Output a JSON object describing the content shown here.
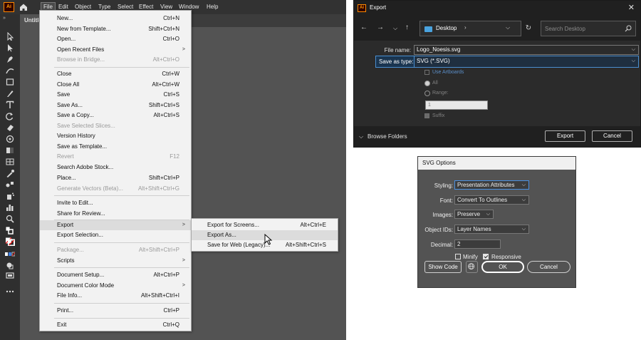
{
  "illustrator": {
    "app_logo": "Ai",
    "menubar": [
      "File",
      "Edit",
      "Object",
      "Type",
      "Select",
      "Effect",
      "View",
      "Window",
      "Help"
    ],
    "doc_tab": "Untitle",
    "file_menu": [
      {
        "label": "New...",
        "shortcut": "Ctrl+N"
      },
      {
        "label": "New from Template...",
        "shortcut": "Shift+Ctrl+N"
      },
      {
        "label": "Open...",
        "shortcut": "Ctrl+O"
      },
      {
        "label": "Open Recent Files",
        "shortcut": ""
      },
      {
        "label": "Browse in Bridge...",
        "shortcut": "Alt+Ctrl+O"
      },
      {
        "label": "Close",
        "shortcut": "Ctrl+W"
      },
      {
        "label": "Close All",
        "shortcut": "Alt+Ctrl+W"
      },
      {
        "label": "Save",
        "shortcut": "Ctrl+S"
      },
      {
        "label": "Save As...",
        "shortcut": "Shift+Ctrl+S"
      },
      {
        "label": "Save a Copy...",
        "shortcut": "Alt+Ctrl+S"
      },
      {
        "label": "Save Selected Slices...",
        "shortcut": ""
      },
      {
        "label": "Version History",
        "shortcut": ""
      },
      {
        "label": "Save as Template...",
        "shortcut": ""
      },
      {
        "label": "Revert",
        "shortcut": "F12"
      },
      {
        "label": "Search Adobe Stock...",
        "shortcut": ""
      },
      {
        "label": "Place...",
        "shortcut": "Shift+Ctrl+P"
      },
      {
        "label": "Generate Vectors (Beta)...",
        "shortcut": "Alt+Shift+Ctrl+G"
      },
      {
        "label": "Invite to Edit...",
        "shortcut": ""
      },
      {
        "label": "Share for Review...",
        "shortcut": ""
      },
      {
        "label": "Export",
        "shortcut": ""
      },
      {
        "label": "Export Selection...",
        "shortcut": ""
      },
      {
        "label": "Package...",
        "shortcut": "Alt+Shift+Ctrl+P"
      },
      {
        "label": "Scripts",
        "shortcut": ""
      },
      {
        "label": "Document Setup...",
        "shortcut": "Alt+Ctrl+P"
      },
      {
        "label": "Document Color Mode",
        "shortcut": ""
      },
      {
        "label": "File Info...",
        "shortcut": "Alt+Shift+Ctrl+I"
      },
      {
        "label": "Print...",
        "shortcut": "Ctrl+P"
      },
      {
        "label": "Exit",
        "shortcut": "Ctrl+Q"
      }
    ],
    "export_submenu": [
      {
        "label": "Export for Screens...",
        "shortcut": "Alt+Ctrl+E"
      },
      {
        "label": "Export As...",
        "shortcut": ""
      },
      {
        "label": "Save for Web (Legacy)...",
        "shortcut": "Alt+Shift+Ctrl+S"
      }
    ]
  },
  "export_dialog": {
    "title": "Export",
    "app_logo": "Ai",
    "path": "Desktop",
    "search_placeholder": "Search Desktop",
    "file_name_label": "File name:",
    "file_name_value": "Logo_Noesis.svg",
    "save_type_label": "Save as type:",
    "save_type_value": "SVG (*.SVG)",
    "use_artboards": "Use Artboards",
    "all_label": "All",
    "range_label": "Range:",
    "range_value": "1",
    "suffix_label": "Suffix",
    "browse_folders": "Browse Folders",
    "export_btn": "Export",
    "cancel_btn": "Cancel"
  },
  "svg_options": {
    "title": "SVG Options",
    "styling_label": "Styling:",
    "styling_value": "Presentation Attributes",
    "font_label": "Font:",
    "font_value": "Convert To Outlines",
    "images_label": "Images:",
    "images_value": "Preserve",
    "object_ids_label": "Object IDs:",
    "object_ids_value": "Layer Names",
    "decimal_label": "Decimal:",
    "decimal_value": "2",
    "minify_label": "Minify",
    "minify_checked": false,
    "responsive_label": "Responsive",
    "responsive_checked": true,
    "show_code_btn": "Show Code",
    "ok_btn": "OK",
    "cancel_btn": "Cancel"
  }
}
